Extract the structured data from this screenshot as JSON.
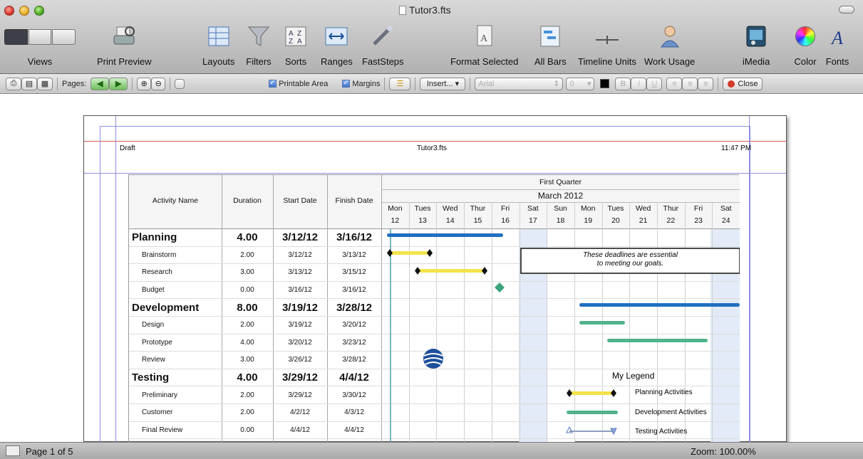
{
  "window": {
    "title": "Tutor3.fts"
  },
  "toolbar": {
    "views": "Views",
    "print_preview": "Print Preview",
    "layouts": "Layouts",
    "filters": "Filters",
    "sorts": "Sorts",
    "ranges": "Ranges",
    "faststeps": "FastSteps",
    "format_selected": "Format Selected",
    "all_bars": "All Bars",
    "timeline_units": "Timeline Units",
    "work_usage": "Work Usage",
    "imedia": "iMedia",
    "color": "Color",
    "fonts": "Fonts"
  },
  "format_bar": {
    "pages_label": "Pages:",
    "printable_area": "Printable Area",
    "margins": "Margins",
    "insert": "Insert...",
    "font": "Arial",
    "font_size": "0",
    "close": "Close",
    "bold": "B",
    "italic": "I",
    "underline": "U"
  },
  "page_header": {
    "left": "Draft",
    "center": "Tutor3.fts",
    "right": "11:47 PM"
  },
  "table": {
    "columns": {
      "name": "Activity Name",
      "duration": "Duration",
      "start": "Start Date",
      "finish": "Finish Date"
    },
    "timescale": {
      "top": "First Quarter",
      "month": "March 2012",
      "days": [
        {
          "d": "Mon",
          "n": "12"
        },
        {
          "d": "Tues",
          "n": "13"
        },
        {
          "d": "Wed",
          "n": "14"
        },
        {
          "d": "Thur",
          "n": "15"
        },
        {
          "d": "Fri",
          "n": "16"
        },
        {
          "d": "Sat",
          "n": "17"
        },
        {
          "d": "Sun",
          "n": "18"
        },
        {
          "d": "Mon",
          "n": "19"
        },
        {
          "d": "Tues",
          "n": "20"
        },
        {
          "d": "Wed",
          "n": "21"
        },
        {
          "d": "Thur",
          "n": "22"
        },
        {
          "d": "Fri",
          "n": "23"
        },
        {
          "d": "Sat",
          "n": "24"
        }
      ]
    },
    "rows": [
      {
        "name": "Planning",
        "dur": "4.00",
        "start": "3/12/12",
        "finish": "3/16/12",
        "group": true
      },
      {
        "name": "Brainstorm",
        "dur": "2.00",
        "start": "3/12/12",
        "finish": "3/13/12"
      },
      {
        "name": "Research",
        "dur": "3.00",
        "start": "3/13/12",
        "finish": "3/15/12"
      },
      {
        "name": "Budget",
        "dur": "0.00",
        "start": "3/16/12",
        "finish": "3/16/12"
      },
      {
        "name": "Development",
        "dur": "8.00",
        "start": "3/19/12",
        "finish": "3/28/12",
        "group": true
      },
      {
        "name": "Design",
        "dur": "2.00",
        "start": "3/19/12",
        "finish": "3/20/12"
      },
      {
        "name": "Prototype",
        "dur": "4.00",
        "start": "3/20/12",
        "finish": "3/23/12"
      },
      {
        "name": "Review",
        "dur": "3.00",
        "start": "3/26/12",
        "finish": "3/28/12"
      },
      {
        "name": "Testing",
        "dur": "4.00",
        "start": "3/29/12",
        "finish": "4/4/12",
        "group": true
      },
      {
        "name": "Preliminary",
        "dur": "2.00",
        "start": "3/29/12",
        "finish": "3/30/12"
      },
      {
        "name": "Customer",
        "dur": "2.00",
        "start": "4/2/12",
        "finish": "4/3/12"
      },
      {
        "name": "Final Review",
        "dur": "0.00",
        "start": "4/4/12",
        "finish": "4/4/12"
      }
    ]
  },
  "annotation": {
    "line1": "These deadlines are essential",
    "line2": "to meeting our goals."
  },
  "legend": {
    "title": "My Legend",
    "items": [
      "Planning Activities",
      "Development Activities",
      "Testing Activities"
    ]
  },
  "colors": {
    "planning_bar": "#f3e34a",
    "development_bar": "#4fb38a",
    "summary_bar": "#1f6fc0",
    "testing_bar": "#8aa0b8"
  },
  "statusbar": {
    "page": "Page 1 of 5",
    "zoom": "Zoom: 100.00%"
  }
}
